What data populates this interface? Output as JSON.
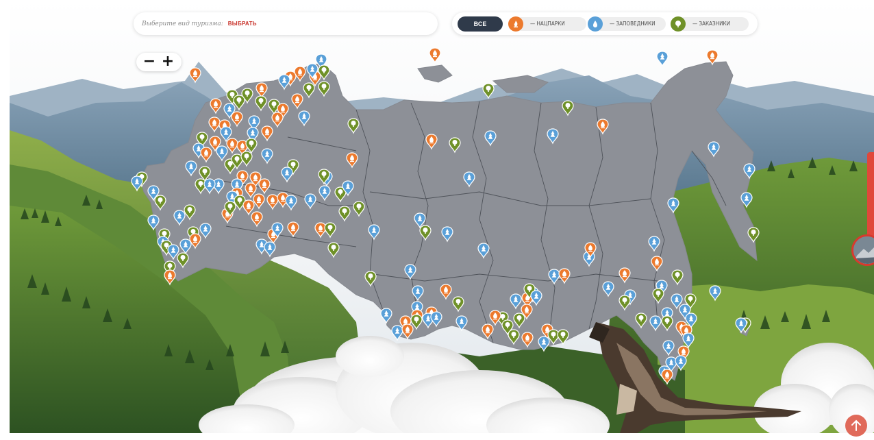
{
  "search": {
    "placeholder": "Выберите вид туризма:",
    "button_label": "ВЫБРАТЬ"
  },
  "filters": {
    "all_label": "ВСЕ",
    "items": [
      {
        "label": "— НАЦПАРКИ",
        "color": "#ec7a2e",
        "icon": "campfire-icon"
      },
      {
        "label": "— ЗАПОВЕДНИКИ",
        "color": "#5aa0d8",
        "icon": "drop-icon"
      },
      {
        "label": "— ЗАКАЗНИКИ",
        "color": "#6f9128",
        "icon": "tree-icon"
      }
    ]
  },
  "zoom": {
    "minus": "−",
    "plus": "+"
  },
  "colors": {
    "territory": "#8d9097",
    "border": "#4e5259",
    "np": "#ec7a2e",
    "zp": "#5aa0d8",
    "zk": "#6f9128",
    "all_chip": "#2f3a4a",
    "accent_red": "#d83a2e"
  },
  "icons": {
    "scroll_up": "arrow-up-icon",
    "side": "story-avatar-icon"
  }
}
